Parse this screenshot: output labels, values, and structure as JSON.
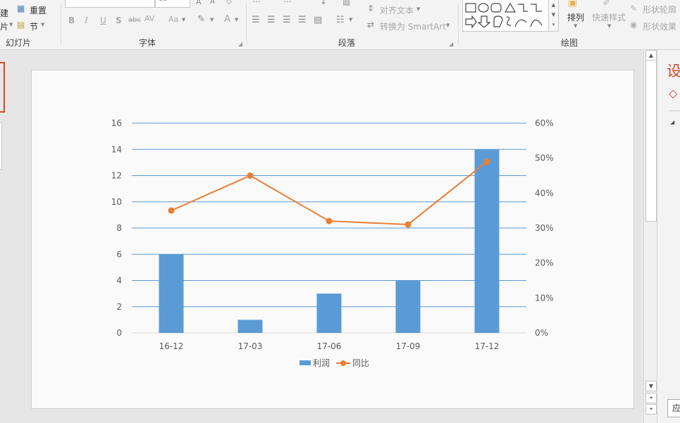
{
  "ribbon": {
    "slides_group": {
      "label": "幻灯片",
      "new_label_top": "建",
      "new_label_bottom": "片",
      "reset_label": "重置",
      "section_label": "节"
    },
    "font_group": {
      "label": "字体",
      "font_size": "18",
      "bold": "B",
      "italic": "I",
      "underline": "U",
      "shadow": "S",
      "strike": "abc",
      "spacing": "AV",
      "case": "Aa",
      "color_a": "A"
    },
    "paragraph_group": {
      "label": "段落",
      "align_text": "对齐文本",
      "convert_smartart": "转换为 SmartArt"
    },
    "drawing_group": {
      "label": "绘图",
      "arrange": "排列",
      "quick_styles": "快速样式",
      "shape_outline": "形状轮廓",
      "shape_effects": "形状效果"
    }
  },
  "right_pane": {
    "title": "设",
    "apply_button": "应"
  },
  "chart_data": {
    "type": "bar",
    "categories": [
      "16-12",
      "17-03",
      "17-06",
      "17-09",
      "17-12"
    ],
    "series": [
      {
        "name": "利润",
        "type": "bar",
        "axis": "left",
        "values": [
          6,
          1,
          3,
          4,
          14
        ],
        "color": "#5b9bd5"
      },
      {
        "name": "同比",
        "type": "line",
        "axis": "right",
        "values": [
          0.35,
          0.45,
          0.32,
          0.31,
          0.49
        ],
        "color": "#ed7d31"
      }
    ],
    "y_left": {
      "min": 0,
      "max": 16,
      "ticks": [
        "0",
        "2",
        "4",
        "6",
        "8",
        "10",
        "12",
        "14",
        "16"
      ]
    },
    "y_right": {
      "min": 0,
      "max": 0.6,
      "ticks": [
        "0%",
        "10%",
        "20%",
        "30%",
        "40%",
        "50%",
        "60%"
      ]
    },
    "grid": true,
    "grid_color": "#5b9bd5",
    "legend_position": "bottom"
  }
}
